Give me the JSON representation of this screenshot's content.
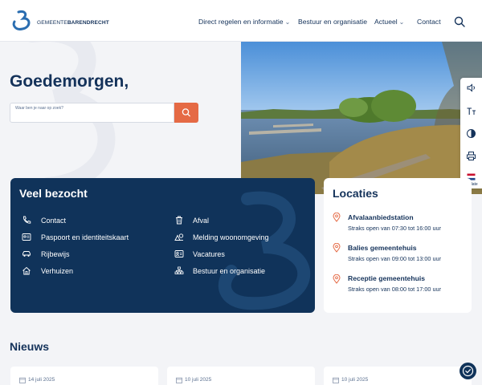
{
  "header": {
    "logo_prefix": "GEMEENTE",
    "logo_name": "BARENDRECHT",
    "nav": [
      {
        "label": "Direct regelen en informatie",
        "has_dropdown": true
      },
      {
        "label": "Bestuur en organisatie",
        "has_dropdown": false
      },
      {
        "label": "Actueel",
        "has_dropdown": true
      },
      {
        "label": "Contact",
        "has_dropdown": false
      }
    ],
    "search_icon": "search-icon"
  },
  "hero": {
    "greeting": "Goedemorgen,",
    "search_placeholder": "Waar ben je naar op zoek?"
  },
  "sidebar": {
    "buttons": [
      "speaker-icon",
      "text-size-icon",
      "contrast-icon",
      "print-icon",
      "flag-nl-icon"
    ],
    "translate_label": "Translate"
  },
  "visited": {
    "title": "Veel bezocht",
    "links": [
      {
        "label": "Contact",
        "icon": "phone-icon"
      },
      {
        "label": "Paspoort en identiteitskaart",
        "icon": "id-card-icon"
      },
      {
        "label": "Rijbewijs",
        "icon": "car-icon"
      },
      {
        "label": "Verhuizen",
        "icon": "house-icon"
      },
      {
        "label": "Afval",
        "icon": "trash-icon"
      },
      {
        "label": "Melding woonomgeving",
        "icon": "report-icon"
      },
      {
        "label": "Vacatures",
        "icon": "vacancy-icon"
      },
      {
        "label": "Bestuur en organisatie",
        "icon": "org-chart-icon"
      }
    ]
  },
  "locations": {
    "title": "Locaties",
    "items": [
      {
        "name": "Afvalaanbiedstation",
        "hours": "Straks open van 07:30 tot 16:00 uur"
      },
      {
        "name": "Balies gemeentehuis",
        "hours": "Straks open van 09:00 tot 13:00 uur"
      },
      {
        "name": "Receptie gemeentehuis",
        "hours": "Straks open van 08:00 tot 17:00 uur"
      }
    ]
  },
  "news": {
    "title": "Nieuws",
    "dates": [
      "14 juli 2025",
      "10 juli 2025",
      "10 juli 2025"
    ]
  },
  "colors": {
    "navy": "#10335a",
    "accent": "#e56a45",
    "background": "#f3f4f7"
  }
}
